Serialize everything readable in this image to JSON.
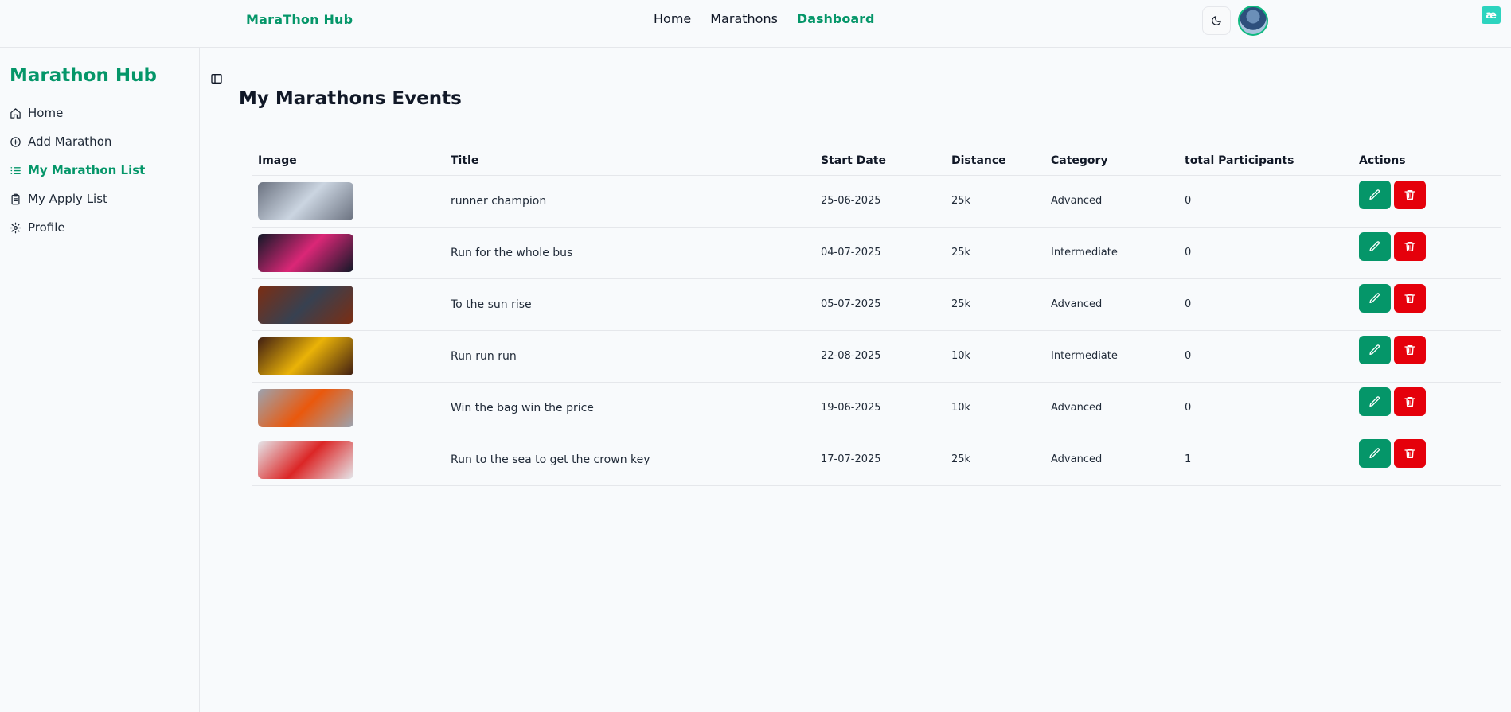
{
  "navbar": {
    "brand": "MaraThon Hub",
    "links": [
      "Home",
      "Marathons",
      "Dashboard"
    ],
    "active_link": "Dashboard",
    "corner_badge": "æ"
  },
  "sidebar": {
    "brand": "Marathon Hub",
    "items": [
      {
        "label": "Home",
        "icon": "home-icon"
      },
      {
        "label": "Add Marathon",
        "icon": "plus-circle-icon"
      },
      {
        "label": "My Marathon List",
        "icon": "list-icon",
        "active": true
      },
      {
        "label": "My Apply List",
        "icon": "clipboard-icon"
      },
      {
        "label": "Profile",
        "icon": "gear-icon"
      }
    ]
  },
  "main": {
    "title": "My Marathons Events",
    "table": {
      "headers": [
        "Image",
        "Title",
        "Start Date",
        "Distance",
        "Category",
        "total Participants",
        "Actions"
      ],
      "rows": [
        {
          "title": "runner champion",
          "start_date": "25-06-2025",
          "distance": "25k",
          "category": "Advanced",
          "participants": "0",
          "thumb_colors": [
            "#6b7280",
            "#cbd5e1"
          ]
        },
        {
          "title": "Run for the whole bus",
          "start_date": "04-07-2025",
          "distance": "25k",
          "category": "Intermediate",
          "participants": "0",
          "thumb_colors": [
            "#111827",
            "#db2777"
          ]
        },
        {
          "title": "To the sun rise",
          "start_date": "05-07-2025",
          "distance": "25k",
          "category": "Advanced",
          "participants": "0",
          "thumb_colors": [
            "#7c2d12",
            "#374151"
          ]
        },
        {
          "title": "Run run run",
          "start_date": "22-08-2025",
          "distance": "10k",
          "category": "Intermediate",
          "participants": "0",
          "thumb_colors": [
            "#3f1d12",
            "#eab308"
          ]
        },
        {
          "title": "Win the bag win the price",
          "start_date": "19-06-2025",
          "distance": "10k",
          "category": "Advanced",
          "participants": "0",
          "thumb_colors": [
            "#9ca3af",
            "#ea580c"
          ]
        },
        {
          "title": "Run to the sea to get the crown key",
          "start_date": "17-07-2025",
          "distance": "25k",
          "category": "Advanced",
          "participants": "1",
          "thumb_colors": [
            "#e5e7eb",
            "#dc2626"
          ]
        }
      ]
    }
  },
  "colors": {
    "brand": "#059669",
    "edit": "#059669",
    "delete": "#e5000b",
    "background": "#f8fafc"
  }
}
